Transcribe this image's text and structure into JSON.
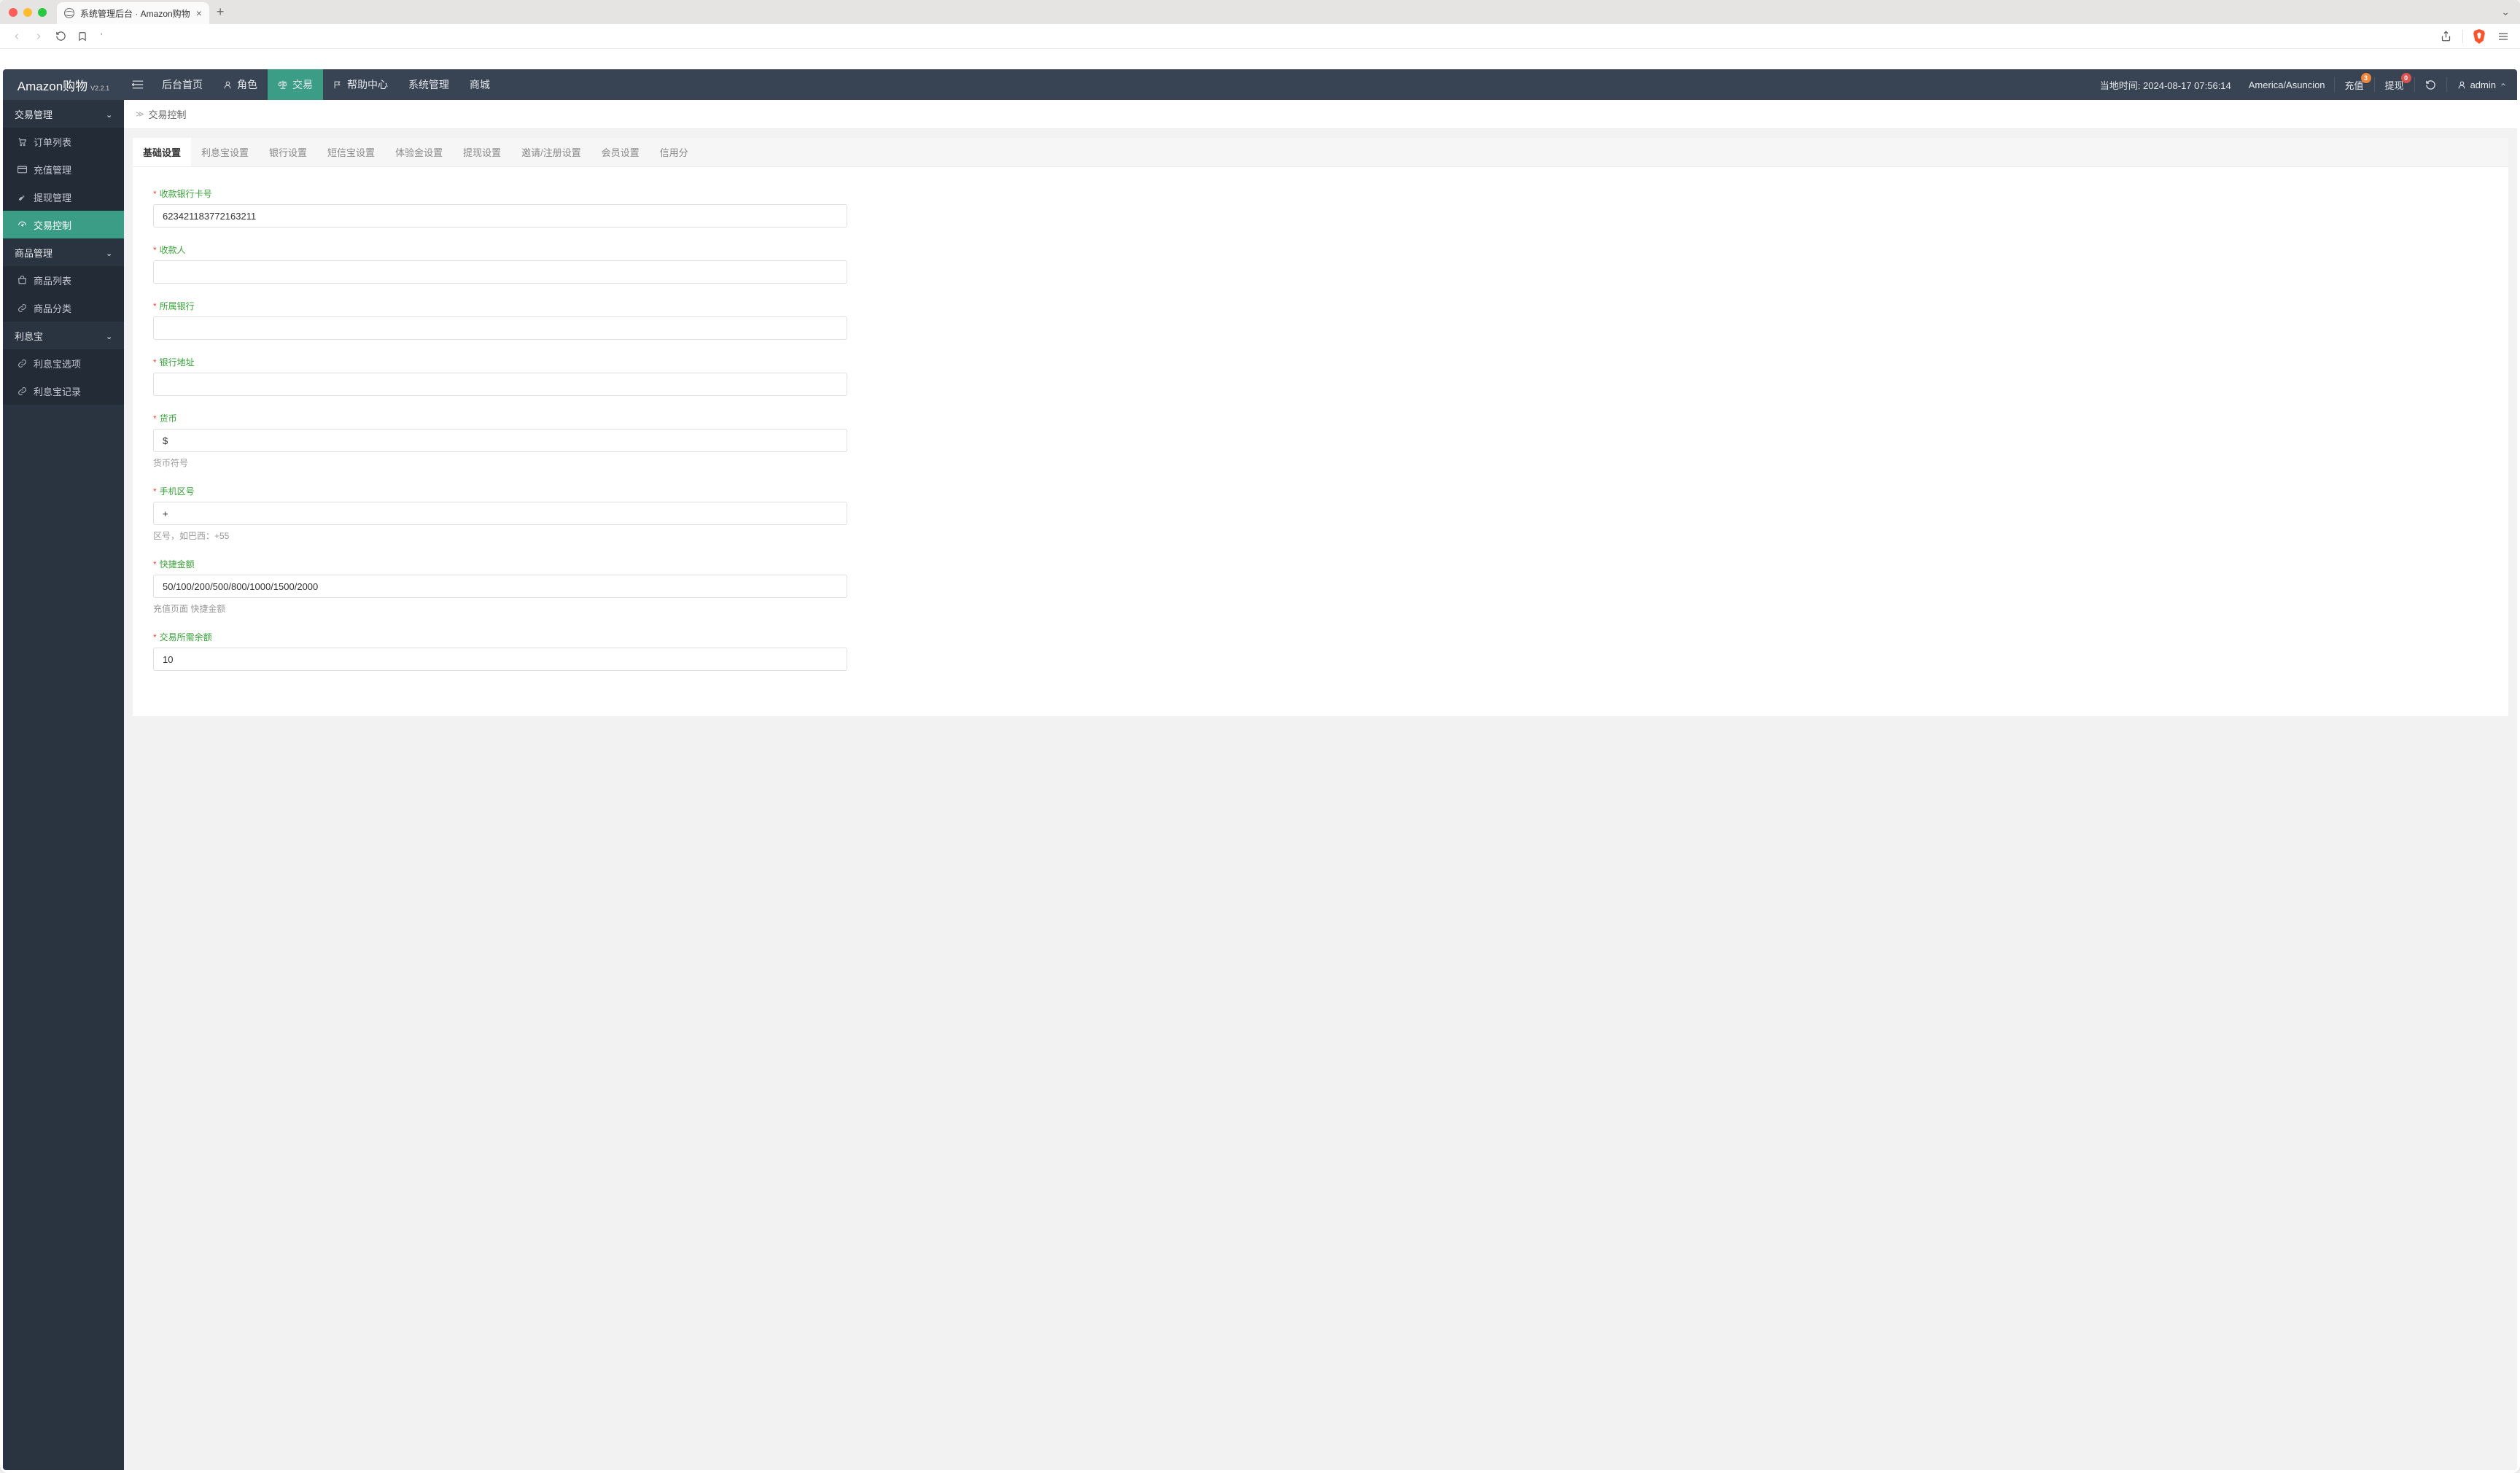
{
  "browser": {
    "tab_title": "系统管理后台 · Amazon购物",
    "url_hint": "'"
  },
  "app": {
    "title": "Amazon购物",
    "version": "V2.2.1"
  },
  "header_nav": [
    {
      "icon": "",
      "label": "后台首页"
    },
    {
      "icon": "user",
      "label": "角色"
    },
    {
      "icon": "scale",
      "label": "交易",
      "active": true
    },
    {
      "icon": "flag",
      "label": "帮助中心"
    },
    {
      "icon": "",
      "label": "系统管理"
    },
    {
      "icon": "",
      "label": "商城"
    }
  ],
  "header_right": {
    "time_label": "当地时间:",
    "time_value": "2024-08-17 07:56:14",
    "timezone": "America/Asuncion",
    "recharge_label": "充值",
    "recharge_badge": "3",
    "withdraw_label": "提现",
    "withdraw_badge": "0",
    "user": "admin"
  },
  "breadcrumb": {
    "current": "交易控制"
  },
  "sidebar": [
    {
      "type": "group",
      "label": "交易管理"
    },
    {
      "type": "item",
      "icon": "cart",
      "label": "订单列表"
    },
    {
      "type": "item",
      "icon": "card",
      "label": "充值管理"
    },
    {
      "type": "item",
      "icon": "wrench",
      "label": "提现管理"
    },
    {
      "type": "item",
      "icon": "gauge",
      "label": "交易控制",
      "active": true
    },
    {
      "type": "group",
      "label": "商品管理"
    },
    {
      "type": "item",
      "icon": "bag",
      "label": "商品列表"
    },
    {
      "type": "item",
      "icon": "link",
      "label": "商品分类"
    },
    {
      "type": "group",
      "label": "利息宝"
    },
    {
      "type": "item",
      "icon": "link",
      "label": "利息宝选项"
    },
    {
      "type": "item",
      "icon": "link",
      "label": "利息宝记录"
    }
  ],
  "tabs": [
    {
      "label": "基础设置",
      "active": true
    },
    {
      "label": "利息宝设置"
    },
    {
      "label": "银行设置"
    },
    {
      "label": "短信宝设置"
    },
    {
      "label": "体验金设置"
    },
    {
      "label": "提现设置"
    },
    {
      "label": "邀请/注册设置"
    },
    {
      "label": "会员设置"
    },
    {
      "label": "信用分"
    }
  ],
  "form": {
    "bank_account": {
      "label": "收款银行卡号",
      "value": "623421183772163211"
    },
    "payee": {
      "label": "收款人",
      "value": ""
    },
    "bank_name": {
      "label": "所属银行",
      "value": ""
    },
    "bank_address": {
      "label": "银行地址",
      "value": ""
    },
    "currency": {
      "label": "货币",
      "value": "$",
      "help": "货币符号"
    },
    "phone_code": {
      "label": "手机区号",
      "value": "+",
      "help": "区号，如巴西：+55"
    },
    "quick_amount": {
      "label": "快捷金额",
      "value": "50/100/200/500/800/1000/1500/2000",
      "help": "充值页面 快捷金额"
    },
    "min_balance": {
      "label": "交易所需余额",
      "value": "10"
    }
  }
}
